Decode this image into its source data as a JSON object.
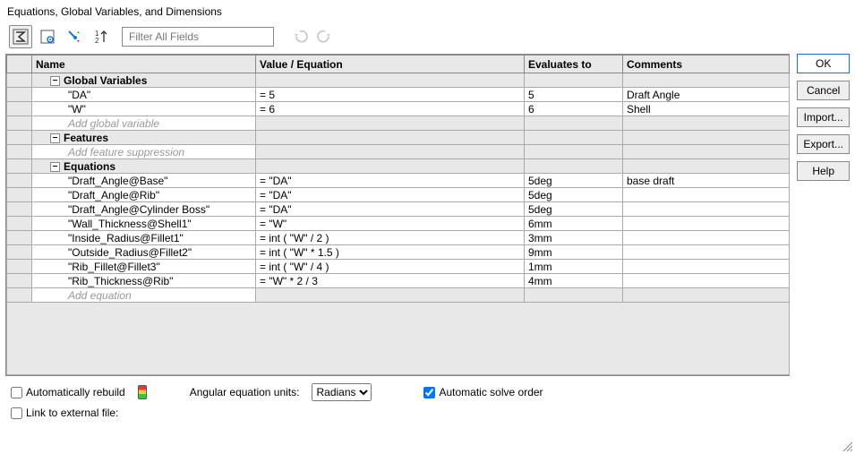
{
  "title": "Equations, Global Variables, and Dimensions",
  "toolbar": {
    "filter_placeholder": "Filter All Fields"
  },
  "columns": {
    "name": "Name",
    "value": "Value / Equation",
    "evaluates": "Evaluates to",
    "comments": "Comments"
  },
  "sections": {
    "global_variables": {
      "label": "Global Variables",
      "placeholder": "Add global variable",
      "rows": [
        {
          "name": "\"DA\"",
          "value": "= 5",
          "evaluates": "5",
          "comments": "Draft Angle"
        },
        {
          "name": "\"W\"",
          "value": "= 6",
          "evaluates": "6",
          "comments": "Shell"
        }
      ]
    },
    "features": {
      "label": "Features",
      "placeholder": "Add feature suppression",
      "rows": []
    },
    "equations": {
      "label": "Equations",
      "placeholder": "Add equation",
      "rows": [
        {
          "name": "\"Draft_Angle@Base\"",
          "value": "= \"DA\"",
          "evaluates": "5deg",
          "comments": "base draft"
        },
        {
          "name": "\"Draft_Angle@Rib\"",
          "value": "= \"DA\"",
          "evaluates": "5deg",
          "comments": ""
        },
        {
          "name": "\"Draft_Angle@Cylinder Boss\"",
          "value": "= \"DA\"",
          "evaluates": "5deg",
          "comments": ""
        },
        {
          "name": "\"Wall_Thickness@Shell1\"",
          "value": "= \"W\"",
          "evaluates": "6mm",
          "comments": ""
        },
        {
          "name": "\"Inside_Radius@Fillet1\"",
          "value": "= int ( \"W\" / 2 )",
          "evaluates": "3mm",
          "comments": ""
        },
        {
          "name": "\"Outside_Radius@Fillet2\"",
          "value": "= int ( \"W\" * 1.5 )",
          "evaluates": "9mm",
          "comments": ""
        },
        {
          "name": "\"Rib_Fillet@Fillet3\"",
          "value": "= int ( \"W\" / 4 )",
          "evaluates": "1mm",
          "comments": ""
        },
        {
          "name": "\"Rib_Thickness@Rib\"",
          "value": "= \"W\" * 2 / 3",
          "evaluates": "4mm",
          "comments": ""
        }
      ]
    }
  },
  "footer": {
    "auto_rebuild": "Automatically rebuild",
    "angular_label": "Angular equation units:",
    "angular_value": "Radians",
    "auto_solve": "Automatic solve order",
    "link_external": "Link to external file:"
  },
  "buttons": {
    "ok": "OK",
    "cancel": "Cancel",
    "import": "Import...",
    "export": "Export...",
    "help": "Help"
  }
}
